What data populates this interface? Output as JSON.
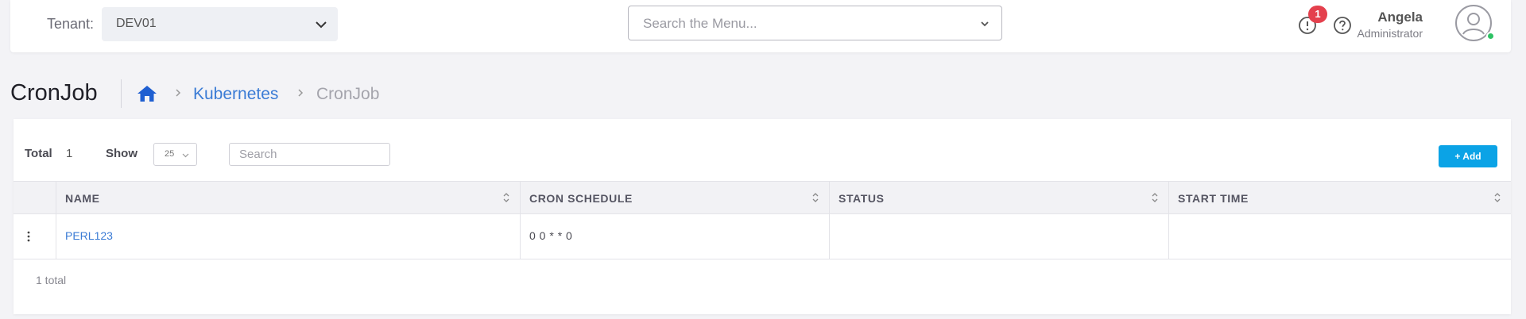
{
  "header": {
    "tenant_label": "Tenant:",
    "tenant_value": "DEV01",
    "menu_search_placeholder": "Search the Menu...",
    "alert_count": "1",
    "user_name": "Angela",
    "user_role": "Administrator",
    "icons": [
      "chevron-down-icon",
      "alert-icon",
      "help-icon",
      "avatar-icon"
    ],
    "colors": {
      "badge": "#e4404d",
      "online": "#2ec264"
    }
  },
  "page": {
    "title": "CronJob",
    "breadcrumb": [
      "Kubernetes",
      "CronJob"
    ],
    "home_icon": "home-icon"
  },
  "toolbar": {
    "total_label": "Total",
    "total_value": "1",
    "show_label": "Show",
    "show_value": "25",
    "search_placeholder": "Search",
    "add_label": "+ Add",
    "add_color": "#0ba3e6"
  },
  "table": {
    "columns": [
      "NAME",
      "CRON SCHEDULE",
      "STATUS",
      "START TIME"
    ],
    "rows": [
      {
        "name": "PERL123",
        "cron_schedule": "0 0 * * 0",
        "status": "",
        "start_time": ""
      }
    ]
  },
  "footer": {
    "total_text": "1 total"
  }
}
